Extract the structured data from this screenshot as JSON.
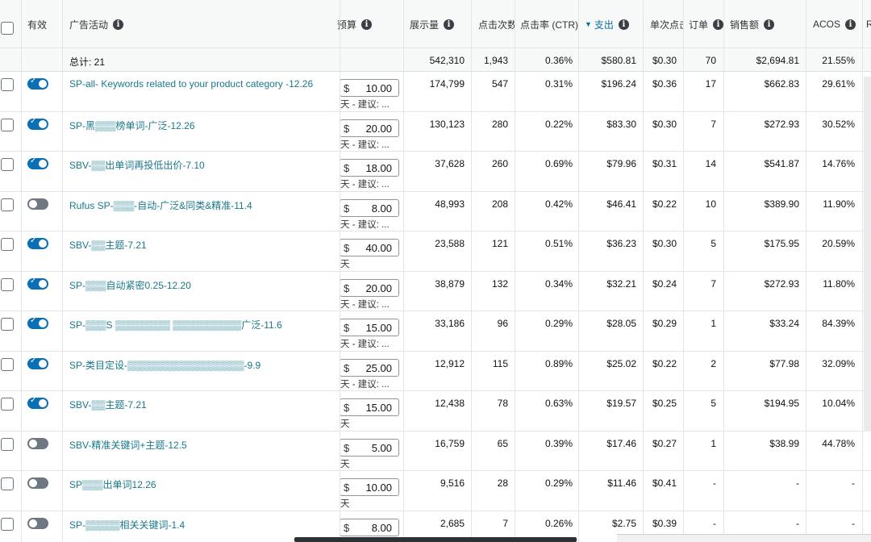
{
  "header": {
    "active": "有效",
    "campaign": "广告活动",
    "budget": "预算",
    "impressions": "展示量",
    "clicks": "点击次数",
    "ctr": "点击率 (CTR)",
    "spend": "支出",
    "cpc": "单次点击",
    "orders": "订单",
    "sales": "销售额",
    "acos": "ACOS",
    "extra": "R"
  },
  "totals": {
    "label": "总计: 21",
    "impressions": "542,310",
    "clicks": "1,943",
    "ctr": "0.36%",
    "spend": "$580.81",
    "cpc": "$0.30",
    "orders": "70",
    "sales": "$2,694.81",
    "acos": "21.55%"
  },
  "rows": [
    {
      "active": true,
      "campaign": "SP-all- Keywords related to your product category -12.26",
      "currency": "$",
      "budget": "10.00",
      "note": "天 - 建议: ...",
      "impressions": "174,799",
      "clicks": "547",
      "ctr": "0.31%",
      "spend": "$196.24",
      "cpc": "$0.36",
      "orders": "17",
      "sales": "$662.83",
      "acos": "29.61%"
    },
    {
      "active": true,
      "campaign": "SP-黑▒▒▒榜单词-广泛-12.26",
      "currency": "$",
      "budget": "20.00",
      "note": "天 - 建议: ...",
      "impressions": "130,123",
      "clicks": "280",
      "ctr": "0.22%",
      "spend": "$83.30",
      "cpc": "$0.30",
      "orders": "7",
      "sales": "$272.93",
      "acos": "30.52%"
    },
    {
      "active": true,
      "campaign": "SBV-▒▒出单词再投低出价-7.10",
      "currency": "$",
      "budget": "18.00",
      "note": "天 - 建议: ...",
      "impressions": "37,628",
      "clicks": "260",
      "ctr": "0.69%",
      "spend": "$79.96",
      "cpc": "$0.31",
      "orders": "14",
      "sales": "$541.87",
      "acos": "14.76%"
    },
    {
      "active": false,
      "campaign": "Rufus SP-▒▒▒-自动-广泛&同类&精准-11.4",
      "currency": "$",
      "budget": "8.00",
      "note": "天 - 建议: ...",
      "impressions": "48,993",
      "clicks": "208",
      "ctr": "0.42%",
      "spend": "$46.41",
      "cpc": "$0.22",
      "orders": "10",
      "sales": "$389.90",
      "acos": "11.90%"
    },
    {
      "active": true,
      "campaign": "SBV-▒▒主题-7.21",
      "currency": "$",
      "budget": "40.00",
      "note": "天",
      "impressions": "23,588",
      "clicks": "121",
      "ctr": "0.51%",
      "spend": "$36.23",
      "cpc": "$0.30",
      "orders": "5",
      "sales": "$175.95",
      "acos": "20.59%"
    },
    {
      "active": true,
      "campaign": "SP-▒▒▒自动紧密0.25-12.20",
      "currency": "$",
      "budget": "20.00",
      "note": "天 - 建议: ...",
      "impressions": "38,879",
      "clicks": "132",
      "ctr": "0.34%",
      "spend": "$32.21",
      "cpc": "$0.24",
      "orders": "7",
      "sales": "$272.93",
      "acos": "11.80%"
    },
    {
      "active": true,
      "campaign": "SP-▒▒▒S ▒▒▒▒▒▒▒▒ ▒▒▒▒▒▒▒▒▒▒广泛-11.6",
      "currency": "$",
      "budget": "15.00",
      "note": "天 - 建议: ...",
      "impressions": "33,186",
      "clicks": "96",
      "ctr": "0.29%",
      "spend": "$28.05",
      "cpc": "$0.29",
      "orders": "1",
      "sales": "$33.24",
      "acos": "84.39%"
    },
    {
      "active": true,
      "campaign": "SP-类目定设-▒▒▒▒▒▒▒▒▒▒▒▒▒▒▒▒▒-9.9",
      "currency": "$",
      "budget": "25.00",
      "note": "天 - 建议: ...",
      "impressions": "12,912",
      "clicks": "115",
      "ctr": "0.89%",
      "spend": "$25.02",
      "cpc": "$0.22",
      "orders": "2",
      "sales": "$77.98",
      "acos": "32.09%"
    },
    {
      "active": true,
      "campaign": "SBV-▒▒主题-7.21",
      "currency": "$",
      "budget": "15.00",
      "note": "天",
      "impressions": "12,438",
      "clicks": "78",
      "ctr": "0.63%",
      "spend": "$19.57",
      "cpc": "$0.25",
      "orders": "5",
      "sales": "$194.95",
      "acos": "10.04%"
    },
    {
      "active": false,
      "campaign": "SBV-精准关键词+主题-12.5",
      "currency": "$",
      "budget": "5.00",
      "note": "天",
      "impressions": "16,759",
      "clicks": "65",
      "ctr": "0.39%",
      "spend": "$17.46",
      "cpc": "$0.27",
      "orders": "1",
      "sales": "$38.99",
      "acos": "44.78%"
    },
    {
      "active": false,
      "campaign": "SP▒▒▒出单词12.26",
      "currency": "$",
      "budget": "10.00",
      "note": "天",
      "impressions": "9,516",
      "clicks": "28",
      "ctr": "0.29%",
      "spend": "$11.46",
      "cpc": "$0.41",
      "orders": "-",
      "sales": "-",
      "acos": "-"
    },
    {
      "active": false,
      "campaign": "SP-▒▒▒▒▒相关关键词-1.4",
      "currency": "$",
      "budget": "8.00",
      "note": "",
      "impressions": "2,685",
      "clicks": "7",
      "ctr": "0.26%",
      "spend": "$2.75",
      "cpc": "$0.39",
      "orders": "-",
      "sales": "-",
      "acos": "-"
    }
  ],
  "colors": {
    "link": "#19788a",
    "toggle_on": "#0a6fb5",
    "toggle_off": "#6f7880",
    "header_bg": "#f7f8f8"
  }
}
